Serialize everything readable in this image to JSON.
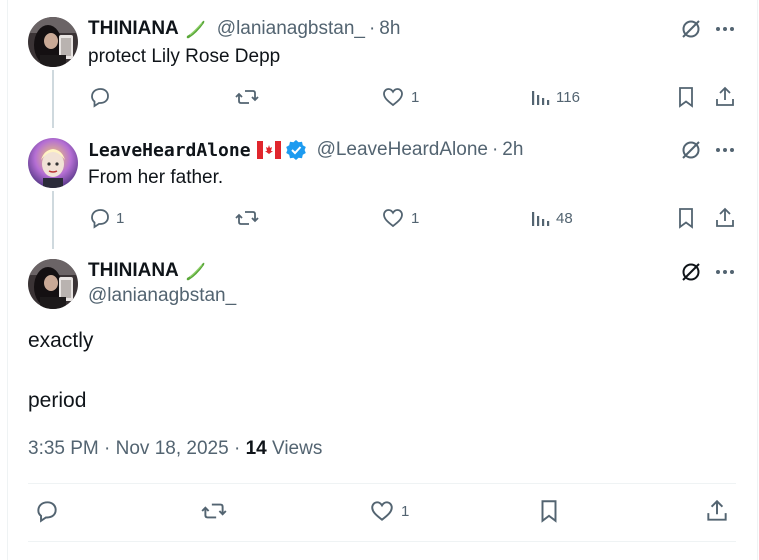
{
  "reply1": {
    "name": "THINIANA",
    "name_emoji": "cucumber",
    "handle": "@lanianagbstan_",
    "time": "8h",
    "text": "protect Lily Rose Depp",
    "replies": "",
    "reposts": "",
    "likes": "1",
    "views": "116"
  },
  "reply2": {
    "name": "LeaveHeardAlone",
    "name_emoji": "canada-flag",
    "verified": true,
    "handle": "@LeaveHeardAlone",
    "time": "2h",
    "text": "From her father.",
    "replies": "1",
    "reposts": "",
    "likes": "1",
    "views": "48"
  },
  "main": {
    "name": "THINIANA",
    "name_emoji": "cucumber",
    "handle": "@lanianagbstan_",
    "line1": "exactly",
    "line2": "period",
    "timestamp": "3:35 PM · Nov 18, 2025",
    "views_count": "14",
    "views_label": "Views",
    "likes": "1"
  },
  "colors": {
    "text": "#0f1419",
    "secondary": "#536471",
    "verified": "#1d9bf0",
    "thread_line": "#cfd9de"
  }
}
